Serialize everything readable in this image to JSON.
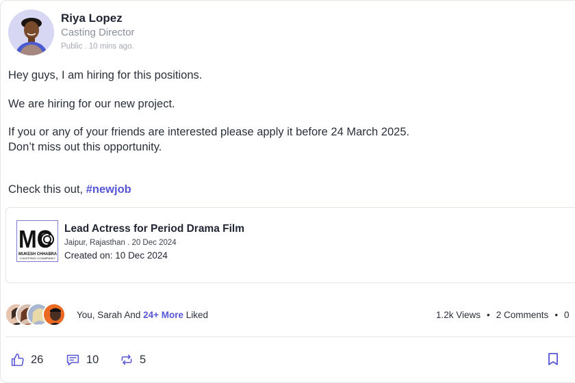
{
  "post": {
    "author_name": "Riya Lopez",
    "author_role": "Casting Director",
    "meta": "Public . 10 mins ago.",
    "lines": [
      "Hey guys, I am hiring for this positions.",
      "We are hiring for our new project.",
      "If you or any of your friends are interested please apply it before 24 March 2025.",
      "Don’t miss out this opportunity."
    ],
    "check_prefix": "Check this out, ",
    "hashtag": "#newjob"
  },
  "job": {
    "logo_initials": "MC",
    "logo_line1": "MUKESH CHHABRA",
    "logo_line2": "CASTING COMPANY",
    "title": "Lead Actress for Period Drama Film",
    "location_date": "Jaipur, Rajasthan  . 20 Dec 2024",
    "created": "Created on: 10 Dec 2024"
  },
  "engagement": {
    "liked_prefix": "You, Sarah And ",
    "liked_more": "24+ More",
    "liked_suffix": " Liked",
    "views": "1.2k Views",
    "comments": "2 Comments",
    "separator": "•",
    "trailing": "0"
  },
  "actions": {
    "likes": "26",
    "comments": "10",
    "reposts": "5"
  },
  "colors": {
    "accent": "#5656d6",
    "avatar_bg": "#d7d6f3",
    "border": "#e2e4ea"
  }
}
